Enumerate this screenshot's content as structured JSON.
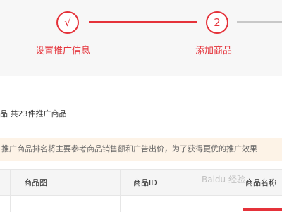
{
  "stepper": {
    "steps": [
      {
        "number": "√",
        "label": "设置推广信息"
      },
      {
        "number": "2",
        "label": "添加商品"
      }
    ]
  },
  "colors": {
    "accent": "#e5323a",
    "inactive_line": "#c8c8c8",
    "notice_bg": "#fdf3e7",
    "header_bg": "#f5f5f5"
  },
  "summary": {
    "text": "品  共23件推广商品"
  },
  "notice": {
    "text": "推广商品排名将主要参考商品销售额和广告出价，为了获得更优的推广效果"
  },
  "table": {
    "columns": [
      "商品图",
      "商品ID",
      "商品名称"
    ]
  },
  "watermark": {
    "text": "Baidu 经验"
  }
}
